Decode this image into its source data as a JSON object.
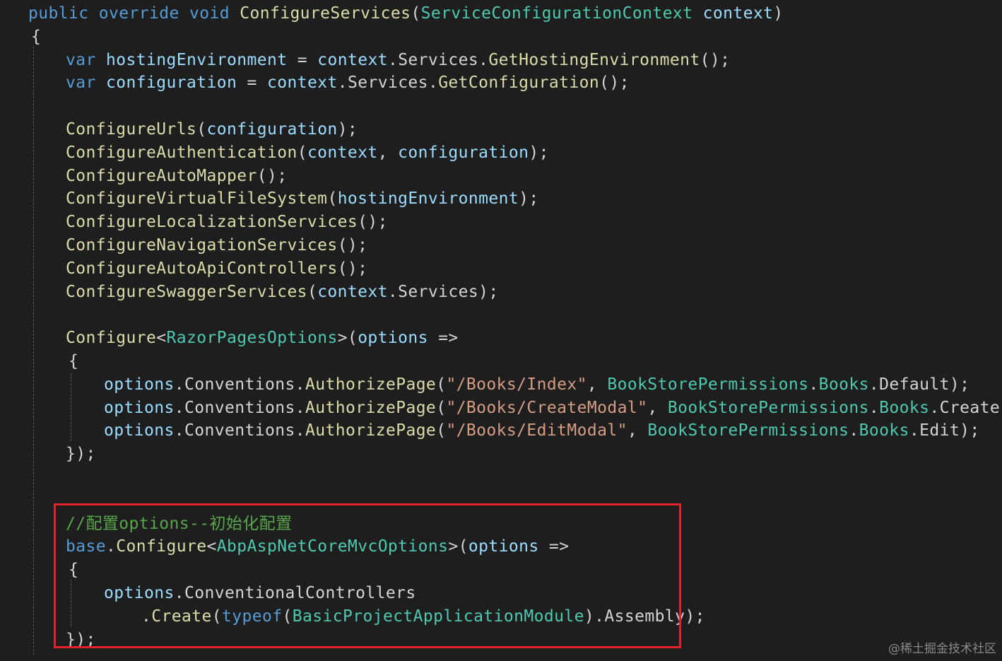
{
  "colors": {
    "background": "#1e1e1e",
    "keyword": "#569cd6",
    "method": "#dcdcaa",
    "type": "#4ec9b0",
    "variable": "#9cdcfe",
    "plain": "#d4d4d4",
    "string": "#d69d85",
    "comment": "#57a64a",
    "highlight_border": "#e0232b"
  },
  "code_lines": [
    [
      [
        "kw",
        "public override void "
      ],
      [
        "fn",
        "ConfigureServices"
      ],
      [
        "pl",
        "("
      ],
      [
        "ty",
        "ServiceConfigurationContext "
      ],
      [
        "var",
        "context"
      ],
      [
        "pl",
        ")"
      ]
    ],
    [
      [
        "pl",
        "{"
      ]
    ],
    [
      [
        "kw",
        "var "
      ],
      [
        "var",
        "hostingEnvironment "
      ],
      [
        "pl",
        "= "
      ],
      [
        "var",
        "context"
      ],
      [
        "pl",
        "."
      ],
      [
        "pl",
        "Services"
      ],
      [
        "pl",
        "."
      ],
      [
        "fn",
        "GetHostingEnvironment"
      ],
      [
        "pl",
        "();"
      ]
    ],
    [
      [
        "kw",
        "var "
      ],
      [
        "var",
        "configuration "
      ],
      [
        "pl",
        "= "
      ],
      [
        "var",
        "context"
      ],
      [
        "pl",
        "."
      ],
      [
        "pl",
        "Services"
      ],
      [
        "pl",
        "."
      ],
      [
        "fn",
        "GetConfiguration"
      ],
      [
        "pl",
        "();"
      ]
    ],
    [],
    [
      [
        "fn",
        "ConfigureUrls"
      ],
      [
        "pl",
        "("
      ],
      [
        "var",
        "configuration"
      ],
      [
        "pl",
        ");"
      ]
    ],
    [
      [
        "fn",
        "ConfigureAuthentication"
      ],
      [
        "pl",
        "("
      ],
      [
        "var",
        "context"
      ],
      [
        "pl",
        ", "
      ],
      [
        "var",
        "configuration"
      ],
      [
        "pl",
        ");"
      ]
    ],
    [
      [
        "fn",
        "ConfigureAutoMapper"
      ],
      [
        "pl",
        "();"
      ]
    ],
    [
      [
        "fn",
        "ConfigureVirtualFileSystem"
      ],
      [
        "pl",
        "("
      ],
      [
        "var",
        "hostingEnvironment"
      ],
      [
        "pl",
        ");"
      ]
    ],
    [
      [
        "fn",
        "ConfigureLocalizationServices"
      ],
      [
        "pl",
        "();"
      ]
    ],
    [
      [
        "fn",
        "ConfigureNavigationServices"
      ],
      [
        "pl",
        "();"
      ]
    ],
    [
      [
        "fn",
        "ConfigureAutoApiControllers"
      ],
      [
        "pl",
        "();"
      ]
    ],
    [
      [
        "fn",
        "ConfigureSwaggerServices"
      ],
      [
        "pl",
        "("
      ],
      [
        "var",
        "context"
      ],
      [
        "pl",
        "."
      ],
      [
        "pl",
        "Services"
      ],
      [
        "pl",
        ");"
      ]
    ],
    [],
    [
      [
        "fn",
        "Configure"
      ],
      [
        "pl",
        "<"
      ],
      [
        "ty",
        "RazorPagesOptions"
      ],
      [
        "pl",
        ">("
      ],
      [
        "var",
        "options "
      ],
      [
        "pl",
        "=>"
      ]
    ],
    [
      [
        "pl",
        "{"
      ]
    ],
    [
      [
        "var",
        "options"
      ],
      [
        "pl",
        "."
      ],
      [
        "pl",
        "Conventions"
      ],
      [
        "pl",
        "."
      ],
      [
        "fn",
        "AuthorizePage"
      ],
      [
        "pl",
        "("
      ],
      [
        "str",
        "\"/Books/Index\""
      ],
      [
        "pl",
        ", "
      ],
      [
        "ty",
        "BookStorePermissions"
      ],
      [
        "pl",
        "."
      ],
      [
        "ty",
        "Books"
      ],
      [
        "pl",
        "."
      ],
      [
        "pl",
        "Default"
      ],
      [
        "pl",
        ");"
      ]
    ],
    [
      [
        "var",
        "options"
      ],
      [
        "pl",
        "."
      ],
      [
        "pl",
        "Conventions"
      ],
      [
        "pl",
        "."
      ],
      [
        "fn",
        "AuthorizePage"
      ],
      [
        "pl",
        "("
      ],
      [
        "str",
        "\"/Books/CreateModal\""
      ],
      [
        "pl",
        ", "
      ],
      [
        "ty",
        "BookStorePermissions"
      ],
      [
        "pl",
        "."
      ],
      [
        "ty",
        "Books"
      ],
      [
        "pl",
        "."
      ],
      [
        "pl",
        "Create"
      ],
      [
        "pl",
        ");"
      ]
    ],
    [
      [
        "var",
        "options"
      ],
      [
        "pl",
        "."
      ],
      [
        "pl",
        "Conventions"
      ],
      [
        "pl",
        "."
      ],
      [
        "fn",
        "AuthorizePage"
      ],
      [
        "pl",
        "("
      ],
      [
        "str",
        "\"/Books/EditModal\""
      ],
      [
        "pl",
        ", "
      ],
      [
        "ty",
        "BookStorePermissions"
      ],
      [
        "pl",
        "."
      ],
      [
        "ty",
        "Books"
      ],
      [
        "pl",
        "."
      ],
      [
        "pl",
        "Edit"
      ],
      [
        "pl",
        ");"
      ]
    ],
    [
      [
        "pl",
        "});"
      ]
    ],
    [],
    [],
    [
      [
        "cm",
        "//配置options--初始化配置"
      ]
    ],
    [
      [
        "kw",
        "base"
      ],
      [
        "pl",
        "."
      ],
      [
        "fn",
        "Configure"
      ],
      [
        "pl",
        "<"
      ],
      [
        "ty",
        "AbpAspNetCoreMvcOptions"
      ],
      [
        "pl",
        ">("
      ],
      [
        "var",
        "options "
      ],
      [
        "pl",
        "=>"
      ]
    ],
    [
      [
        "pl",
        "{"
      ]
    ],
    [
      [
        "var",
        "options"
      ],
      [
        "pl",
        "."
      ],
      [
        "pl",
        "ConventionalControllers"
      ]
    ],
    [
      [
        "pl",
        "."
      ],
      [
        "fn",
        "Create"
      ],
      [
        "pl",
        "("
      ],
      [
        "kw",
        "typeof"
      ],
      [
        "pl",
        "("
      ],
      [
        "ty",
        "BasicProjectApplicationModule"
      ],
      [
        "pl",
        ")."
      ],
      [
        "pl",
        "Assembly"
      ],
      [
        "pl",
        ");"
      ]
    ],
    [
      [
        "pl",
        "});"
      ]
    ]
  ],
  "watermark": "@稀土掘金技术社区"
}
